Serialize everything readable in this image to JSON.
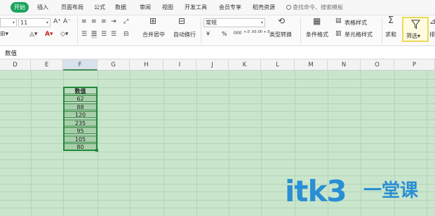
{
  "menu": {
    "tabs": [
      "开始",
      "插入",
      "页面布局",
      "公式",
      "数据",
      "审阅",
      "视图",
      "开发工具",
      "会员专享",
      "稻壳资源"
    ],
    "search_placeholder": "查找命令、搜索模板"
  },
  "ribbon": {
    "font_size": "11",
    "number_format": "常规",
    "merge_label": "合并居中",
    "wrap_label": "自动换行",
    "convert_label": "类型转换",
    "cond_format_label": "条件格式",
    "table_style_label": "表格样式",
    "cell_style_label": "单元格样式",
    "sum_label": "求和",
    "filter_label": "筛选",
    "sort_label": "排序",
    "currency_symbol": "¥",
    "percent_symbol": "%",
    "thousands_symbol": "000",
    "inc_decimal": "+.0 .00",
    "dec_decimal": ".00 +.0"
  },
  "formula_bar": {
    "content": "数值"
  },
  "columns": [
    "D",
    "E",
    "F",
    "G",
    "H",
    "I",
    "J",
    "K",
    "L",
    "M",
    "N",
    "O",
    "P"
  ],
  "selected_column": "F",
  "table": {
    "header": "数值",
    "values": [
      "62",
      "88",
      "120",
      "235",
      "95",
      "105",
      "80"
    ]
  },
  "watermark": {
    "text": "itk3",
    "suffix": "一堂课"
  },
  "colors": {
    "accent": "#1aa45c",
    "grid_bg": "#c9e6cc",
    "grid_line": "#b2d3b6",
    "selection": "#1f8a3a",
    "filter_highlight": "#ecd95a",
    "watermark": "#2a8fd4"
  }
}
